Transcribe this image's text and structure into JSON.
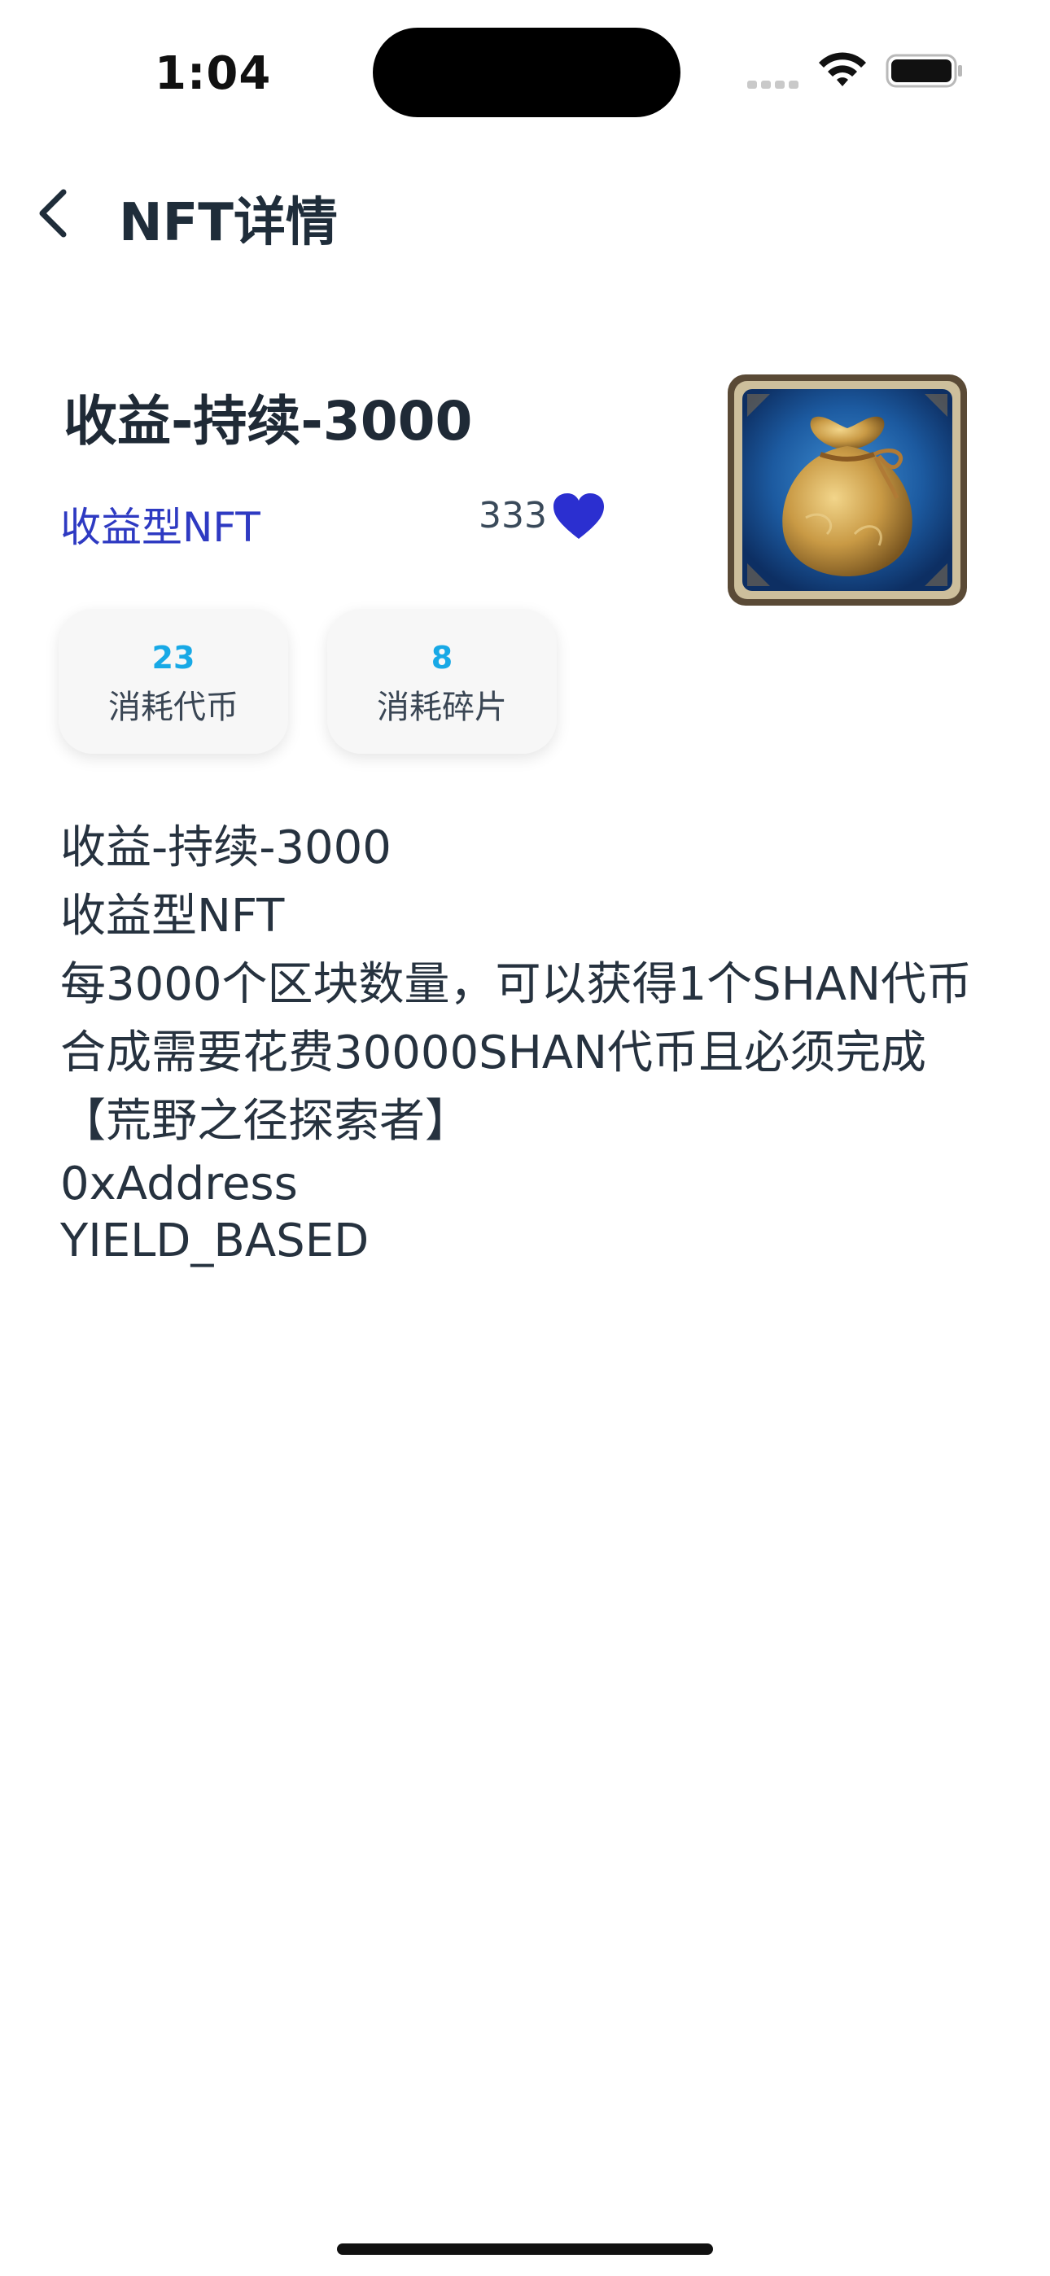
{
  "status_bar": {
    "time": "1:04"
  },
  "nav": {
    "title": "NFT详情"
  },
  "nft": {
    "title": "收益-持续-3000",
    "type_label": "收益型NFT",
    "likes": "333",
    "heart_color": "#2b2fd0",
    "accent_value_color": "#18a9e6"
  },
  "stats": [
    {
      "value": "23",
      "label": "消耗代币"
    },
    {
      "value": "8",
      "label": "消耗碎片"
    }
  ],
  "description": {
    "line1": "收益-持续-3000",
    "line2": "收益型NFT",
    "line3": "每3000个区块数量，可以获得1个SHAN代币",
    "line4": "合成需要花费30000SHAN代币且必须完成【荒野之径探索者】",
    "line5": "0xAddress",
    "line6": "YIELD_BASED"
  }
}
